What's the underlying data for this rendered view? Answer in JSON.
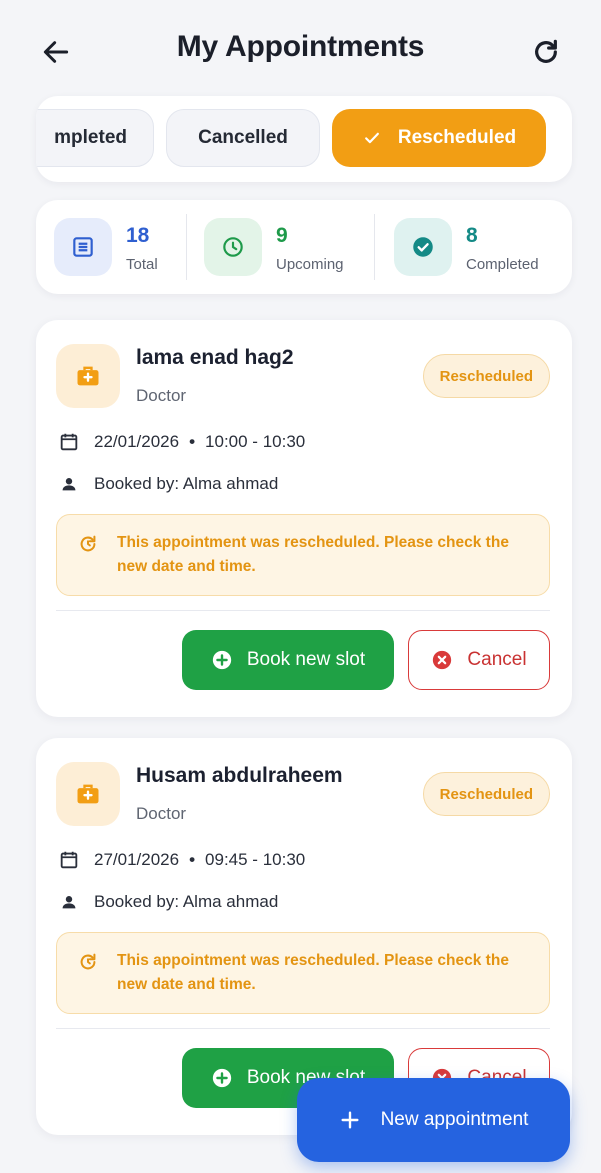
{
  "header": {
    "title": "My Appointments",
    "back_icon": "arrow-left-icon",
    "refresh_icon": "refresh-icon"
  },
  "filters": {
    "chips": [
      {
        "label": "Completed",
        "visible_text": "mpleted",
        "active": false
      },
      {
        "label": "Cancelled",
        "active": false
      },
      {
        "label": "Rescheduled",
        "active": true
      }
    ]
  },
  "stats": [
    {
      "value": "18",
      "label": "Total",
      "icon": "list-icon",
      "color": "#2f5fd0",
      "bg": "#e6ecfb"
    },
    {
      "value": "9",
      "label": "Upcoming",
      "icon": "clock-icon",
      "color": "#1e9a4a",
      "bg": "#e3f4e8"
    },
    {
      "value": "8",
      "label": "Completed",
      "icon": "check-circle-icon",
      "color": "#148a86",
      "bg": "#dff2f0"
    }
  ],
  "appointments": [
    {
      "name": "lama enad hag2",
      "role": "Doctor",
      "status": "Rescheduled",
      "date": "22/01/2026",
      "time": "10:00 - 10:30",
      "booked_by": "Booked by: Alma ahmad",
      "notice": "This appointment was rescheduled. Please check the new date and time.",
      "book_label": "Book new slot",
      "cancel_label": "Cancel"
    },
    {
      "name": "Husam abdulraheem",
      "role": "Doctor",
      "status": "Rescheduled",
      "date": "27/01/2026",
      "time": "09:45 - 10:30",
      "booked_by": "Booked by: Alma ahmad",
      "notice": "This appointment was rescheduled. Please check the new date and time.",
      "book_label": "Book new slot",
      "cancel_label": "Cancel"
    }
  ],
  "fab": {
    "label": "New appointment",
    "icon": "plus-icon"
  },
  "colors": {
    "accent_orange": "#f29e14",
    "primary_blue": "#2563e0",
    "success_green": "#1fa145",
    "danger_red": "#d93a3a"
  }
}
